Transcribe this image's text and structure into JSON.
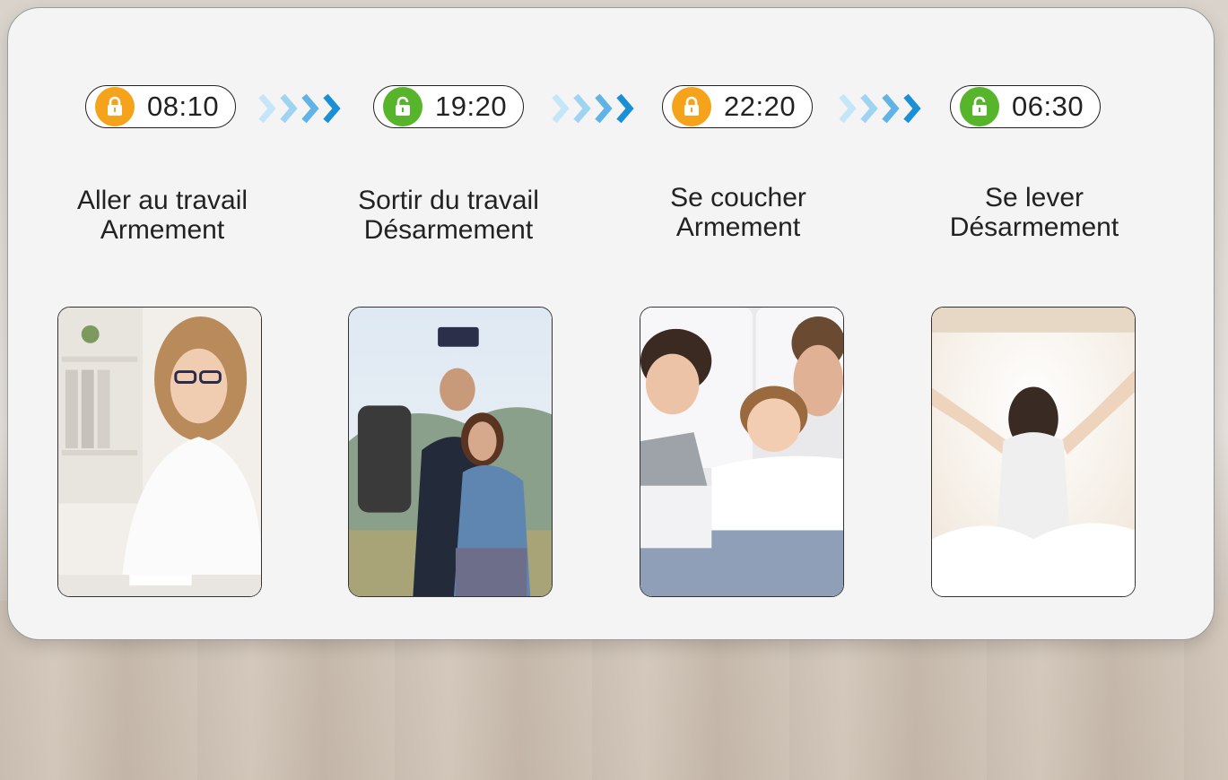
{
  "colors": {
    "armed": "#f5a31a",
    "disarmed": "#56b52a",
    "arrow_light": "#9fd3f2",
    "arrow_dark": "#1a8fd6"
  },
  "steps": [
    {
      "time": "08:10",
      "lock_state": "locked",
      "icon": "lock-icon",
      "activity": "Aller au travail",
      "mode": "Armement"
    },
    {
      "time": "19:20",
      "lock_state": "unlocked",
      "icon": "unlock-icon",
      "activity": "Sortir du travail",
      "mode": "Désarmement"
    },
    {
      "time": "22:20",
      "lock_state": "locked",
      "icon": "lock-icon",
      "activity": "Se coucher",
      "mode": "Armement"
    },
    {
      "time": "06:30",
      "lock_state": "unlocked",
      "icon": "unlock-icon",
      "activity": "Se lever",
      "mode": "Désarmement"
    }
  ]
}
